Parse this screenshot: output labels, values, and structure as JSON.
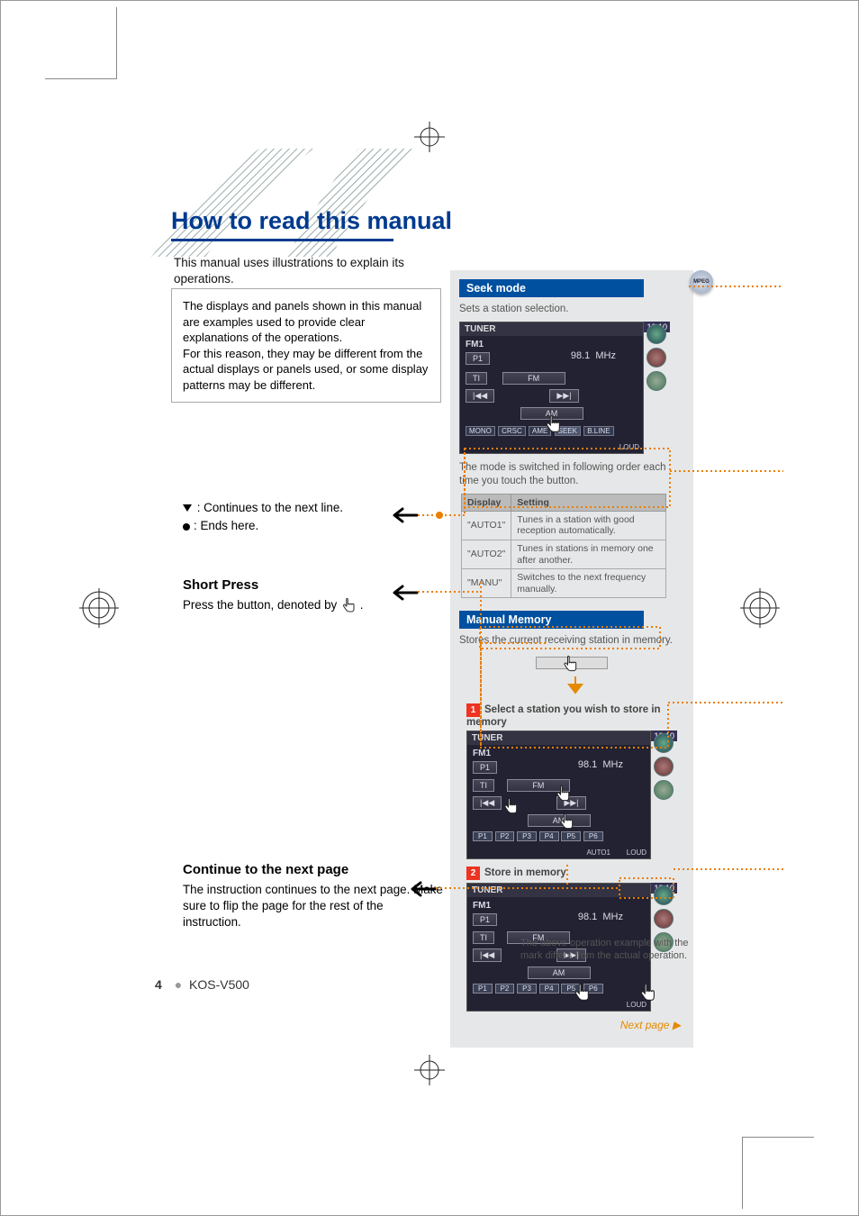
{
  "page": {
    "title": "How to read this manual",
    "intro": "This manual uses illustrations to explain its operations.",
    "disclaimer": "The displays and panels shown in this manual are examples used to provide clear explanations of the operations.\nFor this reason, they may be different from the actual displays or panels used, or some display patterns may be different.",
    "page_number": "4",
    "model": "KOS-V500"
  },
  "left_notes": {
    "continues_line": ": Continues to the next line.",
    "ends_here": ": Ends here.",
    "short_press_heading": "Short Press",
    "short_press_body_prefix": "Press the button, denoted by ",
    "short_press_body_suffix": ".",
    "continue_heading": "Continue to the next page",
    "continue_body": "The instruction continues to the next page. Make sure to flip the page for the rest of the instruction."
  },
  "right": {
    "seek_heading": "Seek mode",
    "seek_desc": "Sets a station selection.",
    "seek_tuner_label": "TUNER",
    "band": "FM1",
    "preset_example": "P1",
    "ti_label": "TI",
    "fm_label": "FM",
    "am_label": "AM",
    "prev_label": "|◀◀",
    "next_label": "▶▶|",
    "freq_value": "98.1",
    "freq_unit": "MHz",
    "clock": "10:10",
    "bottom_btns": [
      "MONO",
      "CRSC",
      "AME",
      "SEEK",
      "B.LINE"
    ],
    "status_loud": "LOUD",
    "mode_switch_text": "The mode is switched in following order each time you touch the button.",
    "table": {
      "head_display": "Display",
      "head_setting": "Setting",
      "rows": [
        {
          "d": "\"AUTO1\"",
          "s": "Tunes in a station with good reception automatically."
        },
        {
          "d": "\"AUTO2\"",
          "s": "Tunes in stations in memory one after another."
        },
        {
          "d": "\"MANU\"",
          "s": "Switches to the next frequency manually."
        }
      ]
    },
    "manual_heading": "Manual Memory",
    "manual_desc": "Stores the current receiving station in memory.",
    "step1_label": "Select a station you wish to store in memory",
    "step2_label": "Store in memory",
    "auto1_status": "AUTO1",
    "presets": [
      "P1",
      "P2",
      "P3",
      "P4",
      "P5",
      "P6"
    ],
    "next_page": "Next page ▶",
    "mpeg_badge": "MPEG"
  },
  "footnote": "The above operation example with the mark differs from the actual operation."
}
